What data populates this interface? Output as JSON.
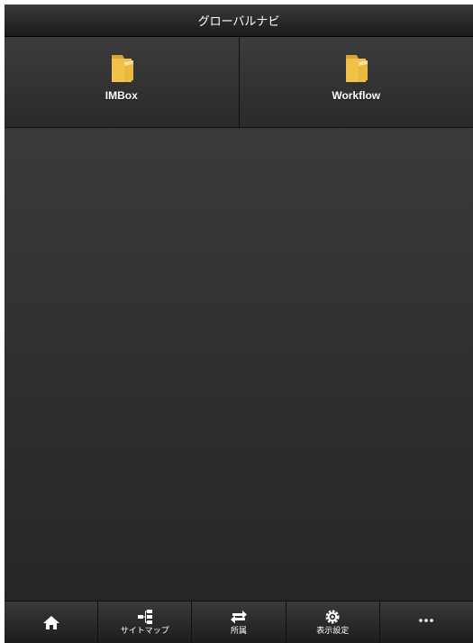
{
  "header": {
    "title": "グローバルナビ"
  },
  "grid": {
    "items": [
      {
        "label": "IMBox",
        "icon": "folder-icon"
      },
      {
        "label": "Workflow",
        "icon": "folder-icon"
      }
    ]
  },
  "footer": {
    "tabs": [
      {
        "label": "",
        "icon": "home-icon"
      },
      {
        "label": "サイトマップ",
        "icon": "sitemap-icon"
      },
      {
        "label": "所属",
        "icon": "swap-arrows-icon"
      },
      {
        "label": "表示設定",
        "icon": "gear-icon"
      },
      {
        "label": "",
        "icon": "more-icon"
      }
    ]
  },
  "colors": {
    "folder": "#f2c14a",
    "background": "#2a2a2a"
  }
}
